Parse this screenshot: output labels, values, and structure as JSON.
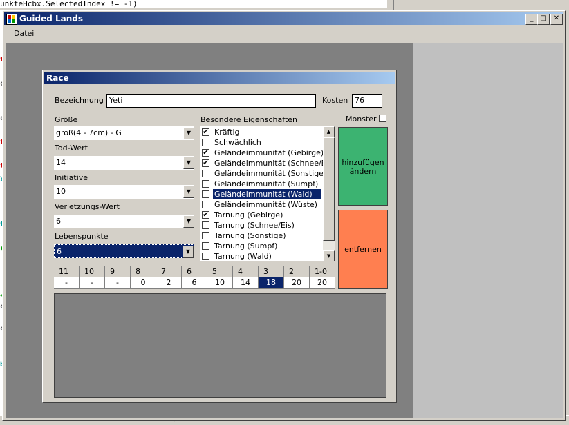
{
  "ide": {
    "code_line": "unkteHcbx.SelectedIndex != -1)",
    "bottom_glyph": ">"
  },
  "window": {
    "title": "Guided Lands",
    "minimize_glyph": "_",
    "maximize_glyph": "□",
    "close_glyph": "✕",
    "menu": [
      "Datei"
    ]
  },
  "race": {
    "title": "Race",
    "bezeichnung_label": "Bezeichnung",
    "bezeichnung_value": "Yeti",
    "kosten_label": "Kosten",
    "kosten_value": "76",
    "monster_label": "Monster",
    "monster_checked": false,
    "groesse_label": "Größe",
    "groesse_value": "groß(4 - 7cm) - G",
    "tod_label": "Tod-Wert",
    "tod_value": "14",
    "initiative_label": "Initiative",
    "initiative_value": "10",
    "verletzung_label": "Verletzungs-Wert",
    "verletzung_value": "6",
    "lebenspunkte_label": "Lebenspunkte",
    "lebenspunkte_value": "6",
    "eigenschaften_label": "Besondere Eigenschaften",
    "eigenschaften": [
      {
        "label": "Kräftig",
        "checked": true
      },
      {
        "label": "Schwächlich",
        "checked": false
      },
      {
        "label": "Geländeimmunität (Gebirge)",
        "checked": true
      },
      {
        "label": "Geländeimmunität (Schnee/Eis)",
        "checked": true
      },
      {
        "label": "Geländeimmunität (Sonstige)",
        "checked": false
      },
      {
        "label": "Geländeimmunität (Sumpf)",
        "checked": false
      },
      {
        "label": "Geländeimmunität (Wald)",
        "checked": false,
        "selected": true
      },
      {
        "label": "Geländeimmunität (Wüste)",
        "checked": false
      },
      {
        "label": "Tarnung (Gebirge)",
        "checked": true
      },
      {
        "label": "Tarnung (Schnee/Eis)",
        "checked": false
      },
      {
        "label": "Tarnung (Sonstige)",
        "checked": false
      },
      {
        "label": "Tarnung (Sumpf)",
        "checked": false
      },
      {
        "label": "Tarnung (Wald)",
        "checked": false
      }
    ],
    "btn_add_line1": "hinzufügen",
    "btn_add_line2": "ändern",
    "btn_remove": "entfernen",
    "colors": {
      "add": "#3cb371",
      "remove": "#ff7f50",
      "selection": "#0a246a"
    },
    "table": {
      "headers": [
        "11",
        "10",
        "9",
        "8",
        "7",
        "6",
        "5",
        "4",
        "3",
        "2",
        "1-0"
      ],
      "values": [
        "-",
        "-",
        "-",
        "0",
        "2",
        "6",
        "10",
        "14",
        "18",
        "20",
        "20"
      ],
      "selected_index": 8
    }
  }
}
